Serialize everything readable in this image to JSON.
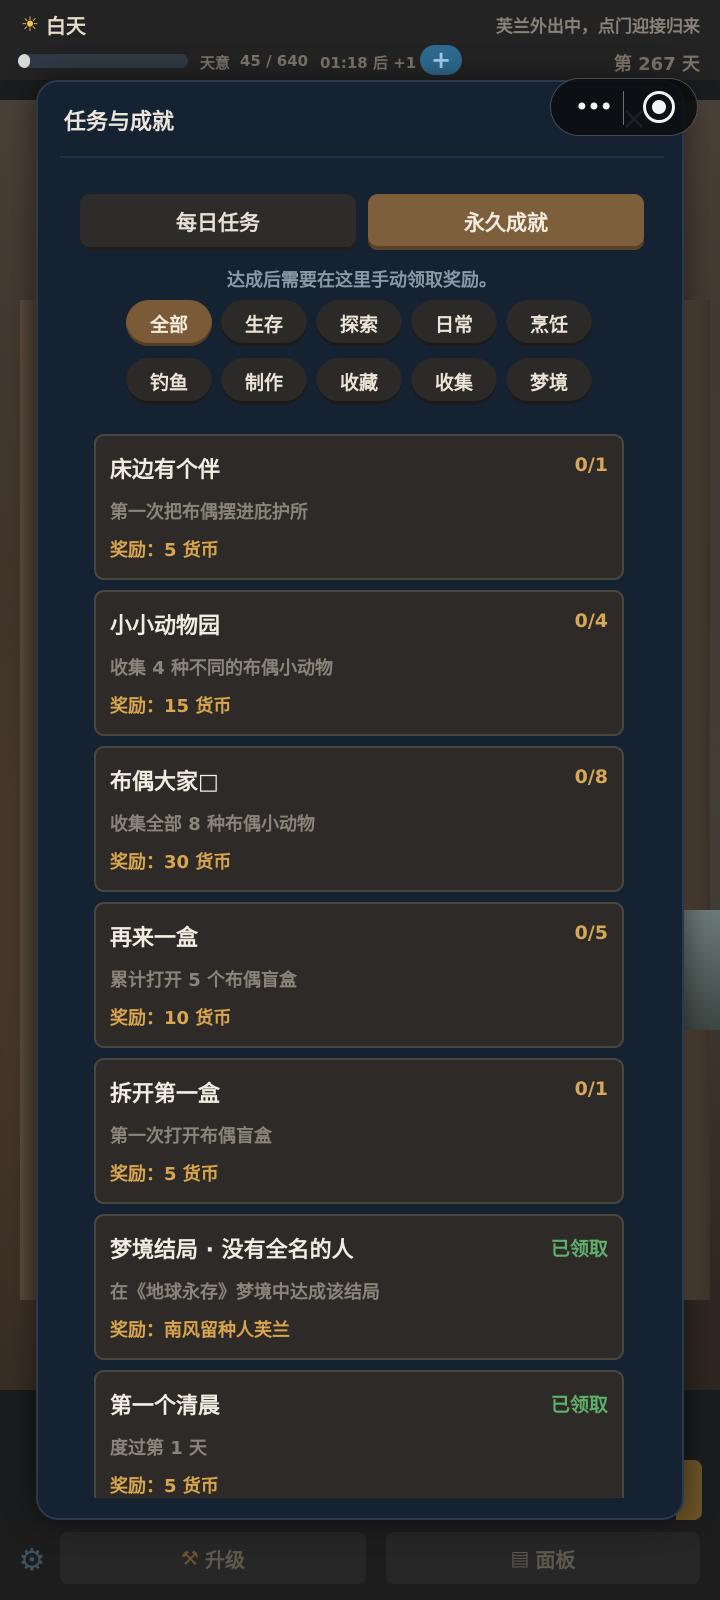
{
  "status": {
    "day_phase": "白天",
    "event": "芙兰外出中，点门迎接归来",
    "tianyi_label": "天意",
    "tianyi_value": "45 / 640",
    "tianyi_progress": 0.07,
    "timer": "01:18 后 +1",
    "plus": "+",
    "day_count": "第 267 天"
  },
  "capsule": {
    "more": "•••"
  },
  "modal": {
    "title": "任务与成就",
    "close": "×",
    "tabs": [
      {
        "label": "每日任务",
        "active": false
      },
      {
        "label": "永久成就",
        "active": true
      }
    ],
    "hint": "达成后需要在这里手动领取奖励。",
    "filters": [
      "全部",
      "生存",
      "探索",
      "日常",
      "烹饪",
      "钓鱼",
      "制作",
      "收藏",
      "收集",
      "梦境"
    ],
    "active_filter": "全部",
    "achievements": [
      {
        "title": "床边有个伴",
        "status": "0/1",
        "desc": "第一次把布偶摆进庇护所",
        "reward": "奖励：5 货币",
        "claimed": false
      },
      {
        "title": "小小动物园",
        "status": "0/4",
        "desc": "收集 4 种不同的布偶小动物",
        "reward": "奖励：15 货币",
        "claimed": false
      },
      {
        "title": "布偶大家□",
        "status": "0/8",
        "desc": "收集全部 8 种布偶小动物",
        "reward": "奖励：30 货币",
        "claimed": false
      },
      {
        "title": "再来一盒",
        "status": "0/5",
        "desc": "累计打开 5 个布偶盲盒",
        "reward": "奖励：10 货币",
        "claimed": false
      },
      {
        "title": "拆开第一盒",
        "status": "0/1",
        "desc": "第一次打开布偶盲盒",
        "reward": "奖励：5 货币",
        "claimed": false
      },
      {
        "title": "梦境结局 · 没有全名的人",
        "status": "已领取",
        "desc": "在《地球永存》梦境中达成该结局",
        "reward": "奖励：南风留种人芙兰",
        "claimed": true
      },
      {
        "title": "第一个清晨",
        "status": "已领取",
        "desc": "度过第 1 天",
        "reward": "奖励：5 货币",
        "claimed": true
      }
    ]
  },
  "bottom": {
    "upgrade_label": "升级",
    "panel_label": "面板",
    "upgrade_icon": "hammer-wrench-icon",
    "panel_icon": "clipboard-icon"
  },
  "colors": {
    "modal_bg": "#152232",
    "accent_brown": "#7e5f3c",
    "reward_gold": "#d9a64e",
    "claimed_green": "#5fb06a"
  }
}
